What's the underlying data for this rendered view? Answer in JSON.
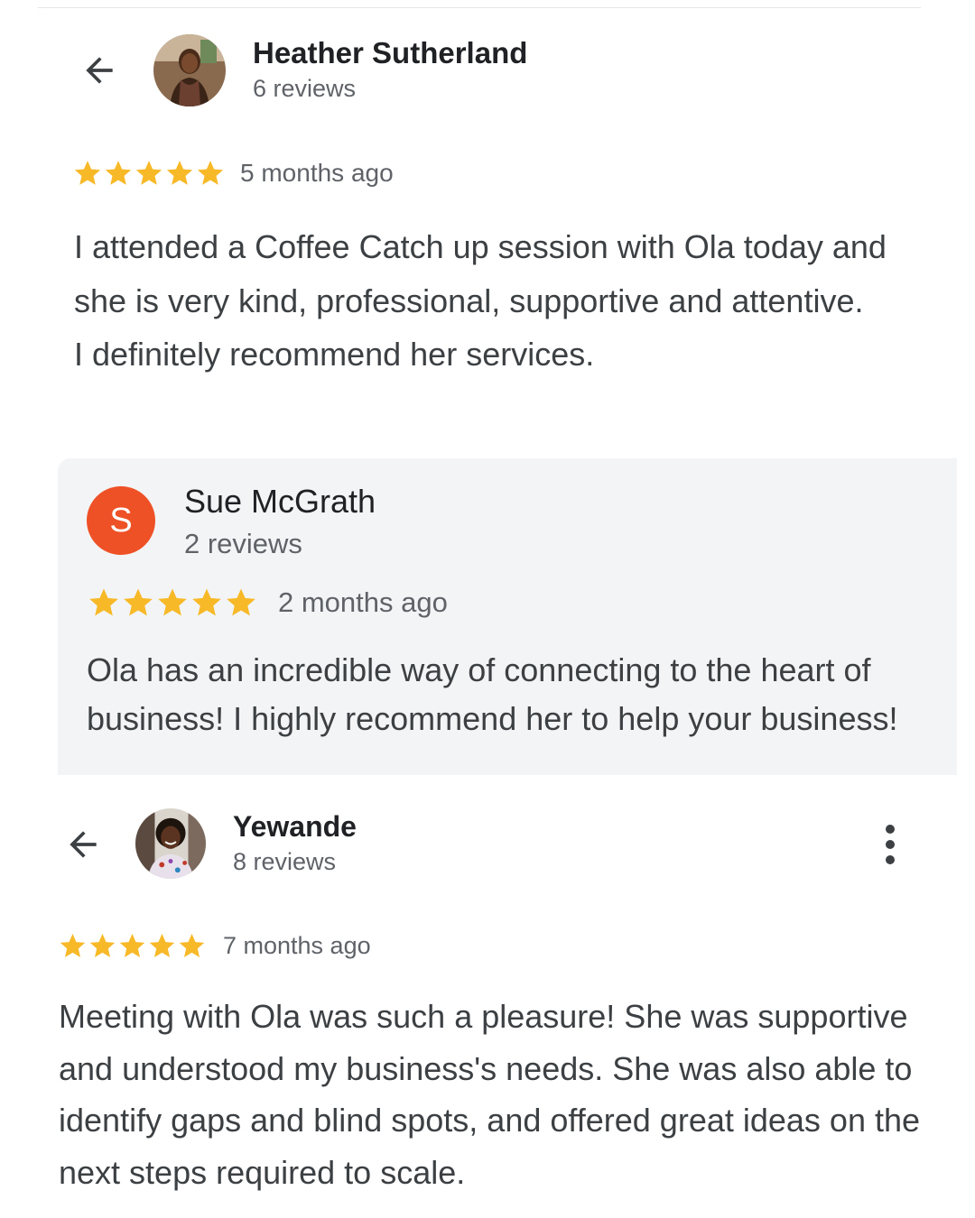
{
  "colors": {
    "star": "#f7b928",
    "card_background": "#f3f4f6",
    "letter_avatar": "#ef5127",
    "secondary_text": "#5f6368"
  },
  "reviews": [
    {
      "author": "Heather Sutherland",
      "review_count": "6 reviews",
      "avatar": "profile-photo",
      "rating": 5,
      "time": "5 months ago",
      "text_lines": [
        "I attended a Coffee Catch up session with Ola today and she is very kind, professional, supportive and attentive.",
        "I definitely recommend her services."
      ],
      "back_icon": "arrow-back-icon"
    },
    {
      "author": "Sue McGrath",
      "review_count": "2 reviews",
      "avatar_letter": "S",
      "rating": 5,
      "time": "2 months ago",
      "text": "Ola has an incredible way of connecting to the heart of business! I highly recommend her to help your business!"
    },
    {
      "author": "Yewande",
      "review_count": "8 reviews",
      "avatar": "profile-photo",
      "rating": 5,
      "time": "7 months ago",
      "text": "Meeting with Ola was such a pleasure! She was supportive and understood my business's needs. She was also able to identify gaps and blind spots, and offered great ideas on the next steps required to scale.",
      "back_icon": "arrow-back-icon",
      "menu_icon": "more-vertical-icon"
    }
  ]
}
